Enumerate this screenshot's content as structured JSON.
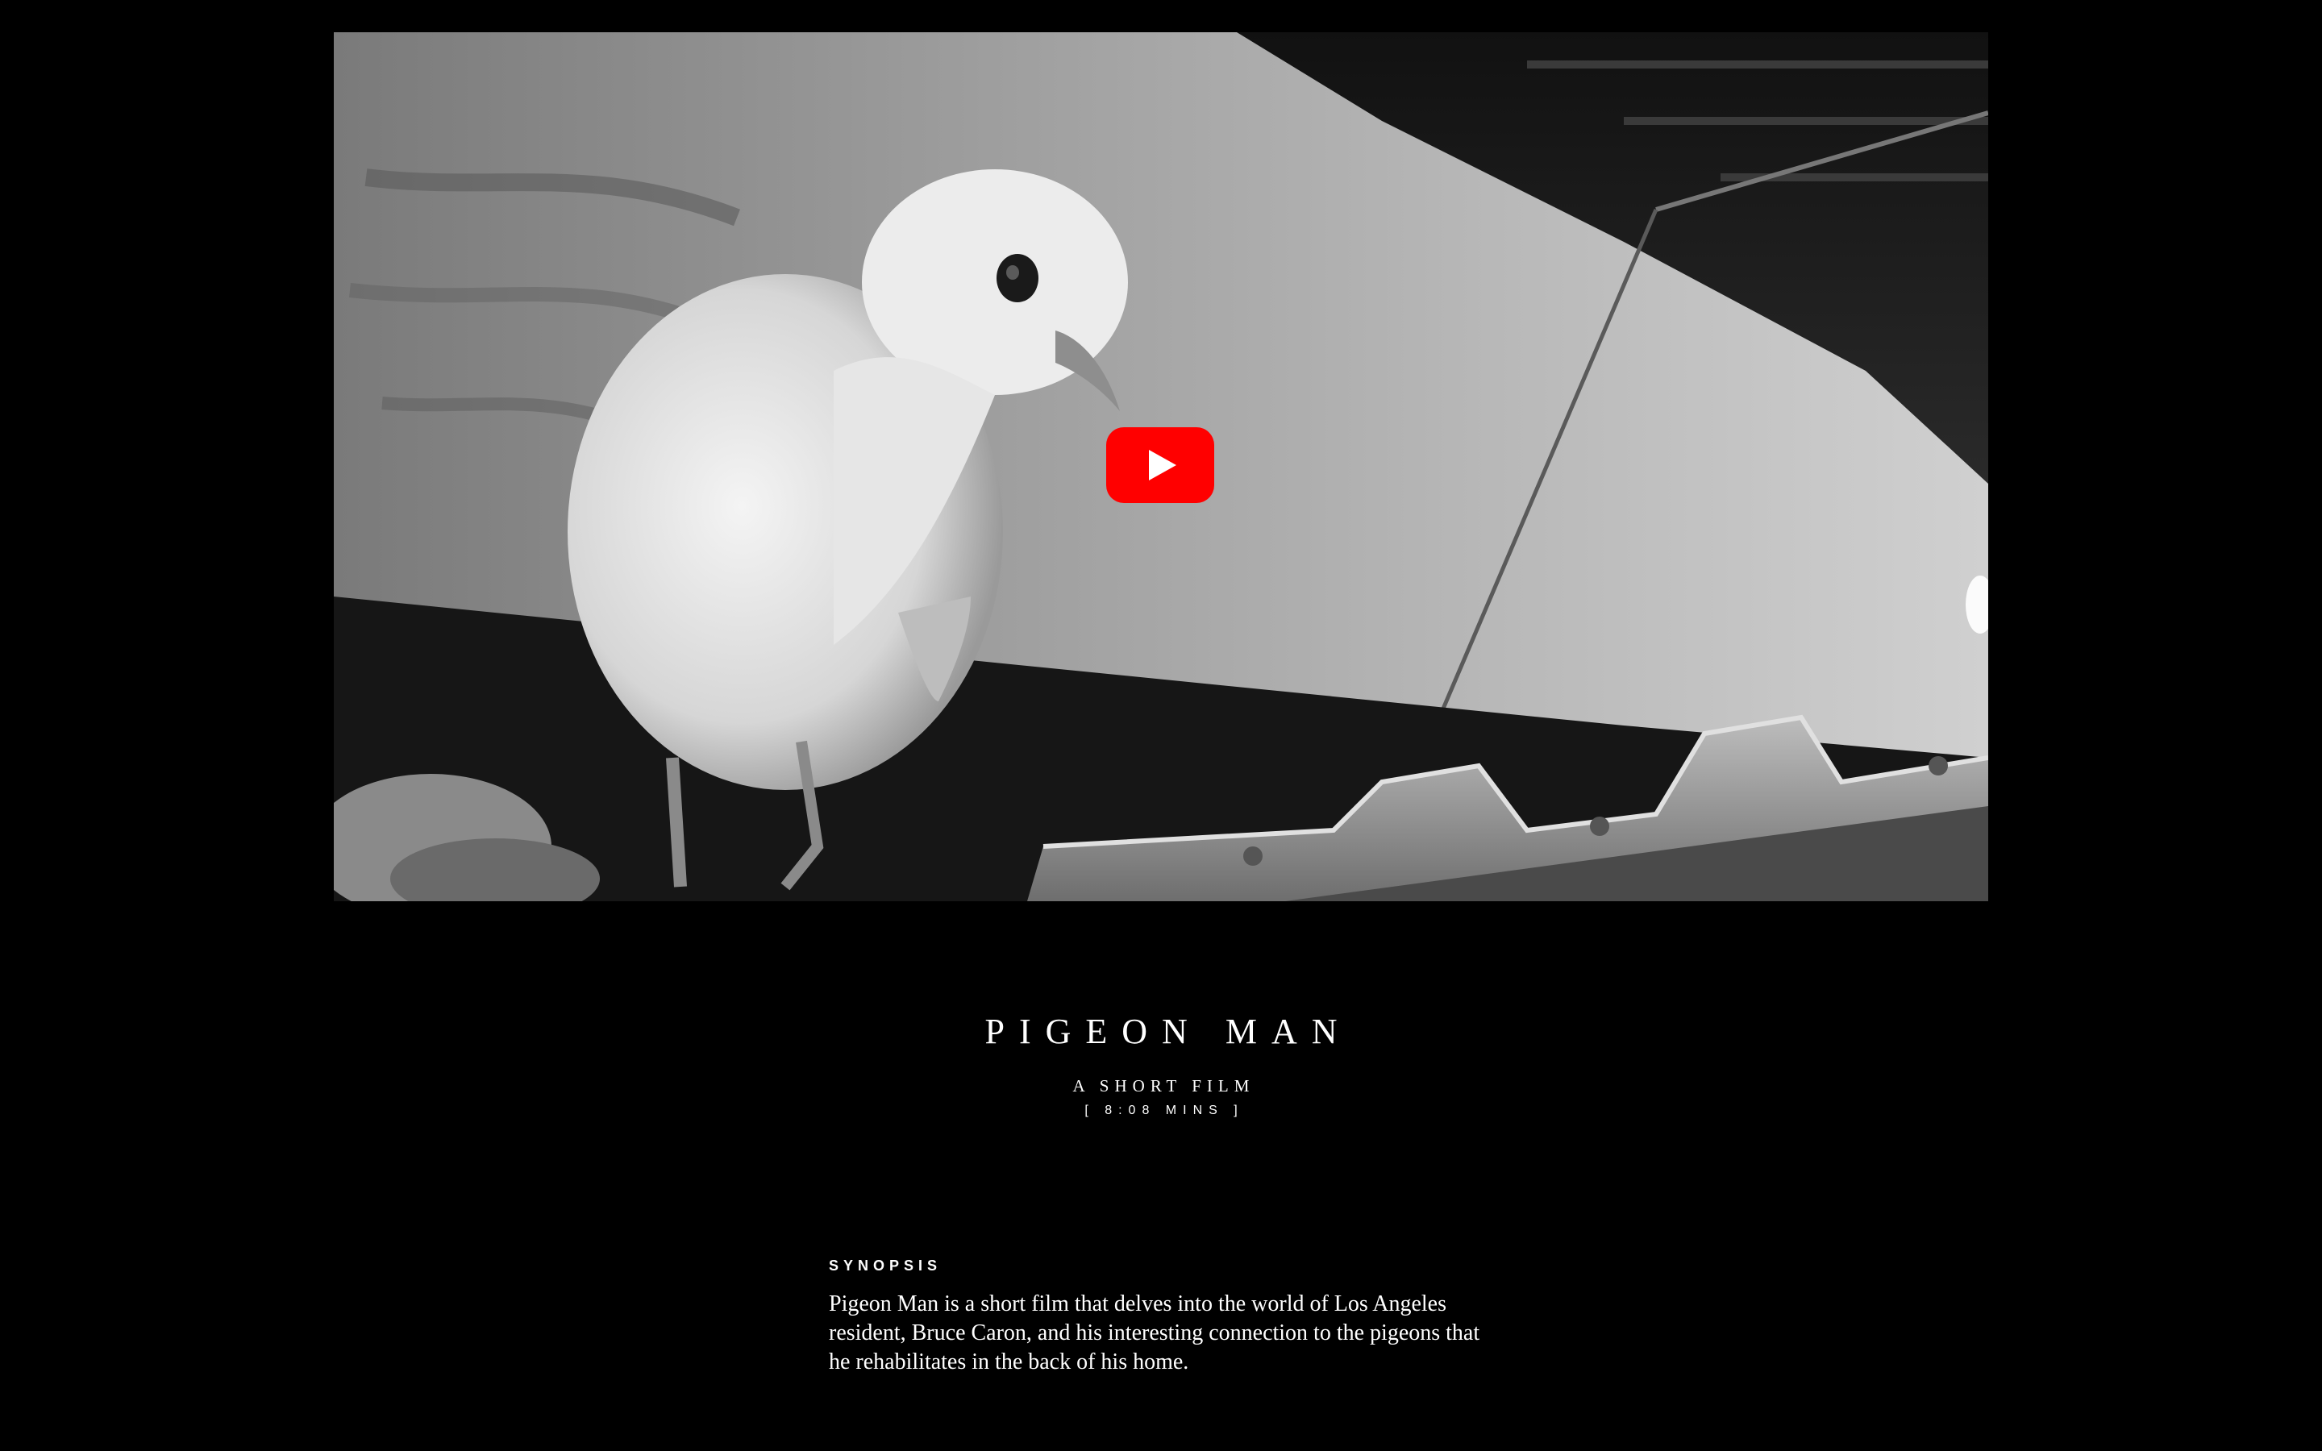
{
  "video": {
    "thumbnail": "pigeon-on-rooftop-black-and-white",
    "play_icon": "youtube-play-icon",
    "play_color": "#ff0000"
  },
  "film": {
    "title": "PIGEON MAN",
    "subtitle": "A SHORT FILM",
    "duration": "[ 8:08 MINS ]"
  },
  "synopsis": {
    "heading": "SYNOPSIS",
    "body": "Pigeon Man is a short film that delves into the world of Los Angeles resident, Bruce Caron, and his interesting connection to the pigeons that he rehabilitates in the back of his home."
  },
  "colors": {
    "background": "#000000",
    "text": "#ffffff"
  }
}
